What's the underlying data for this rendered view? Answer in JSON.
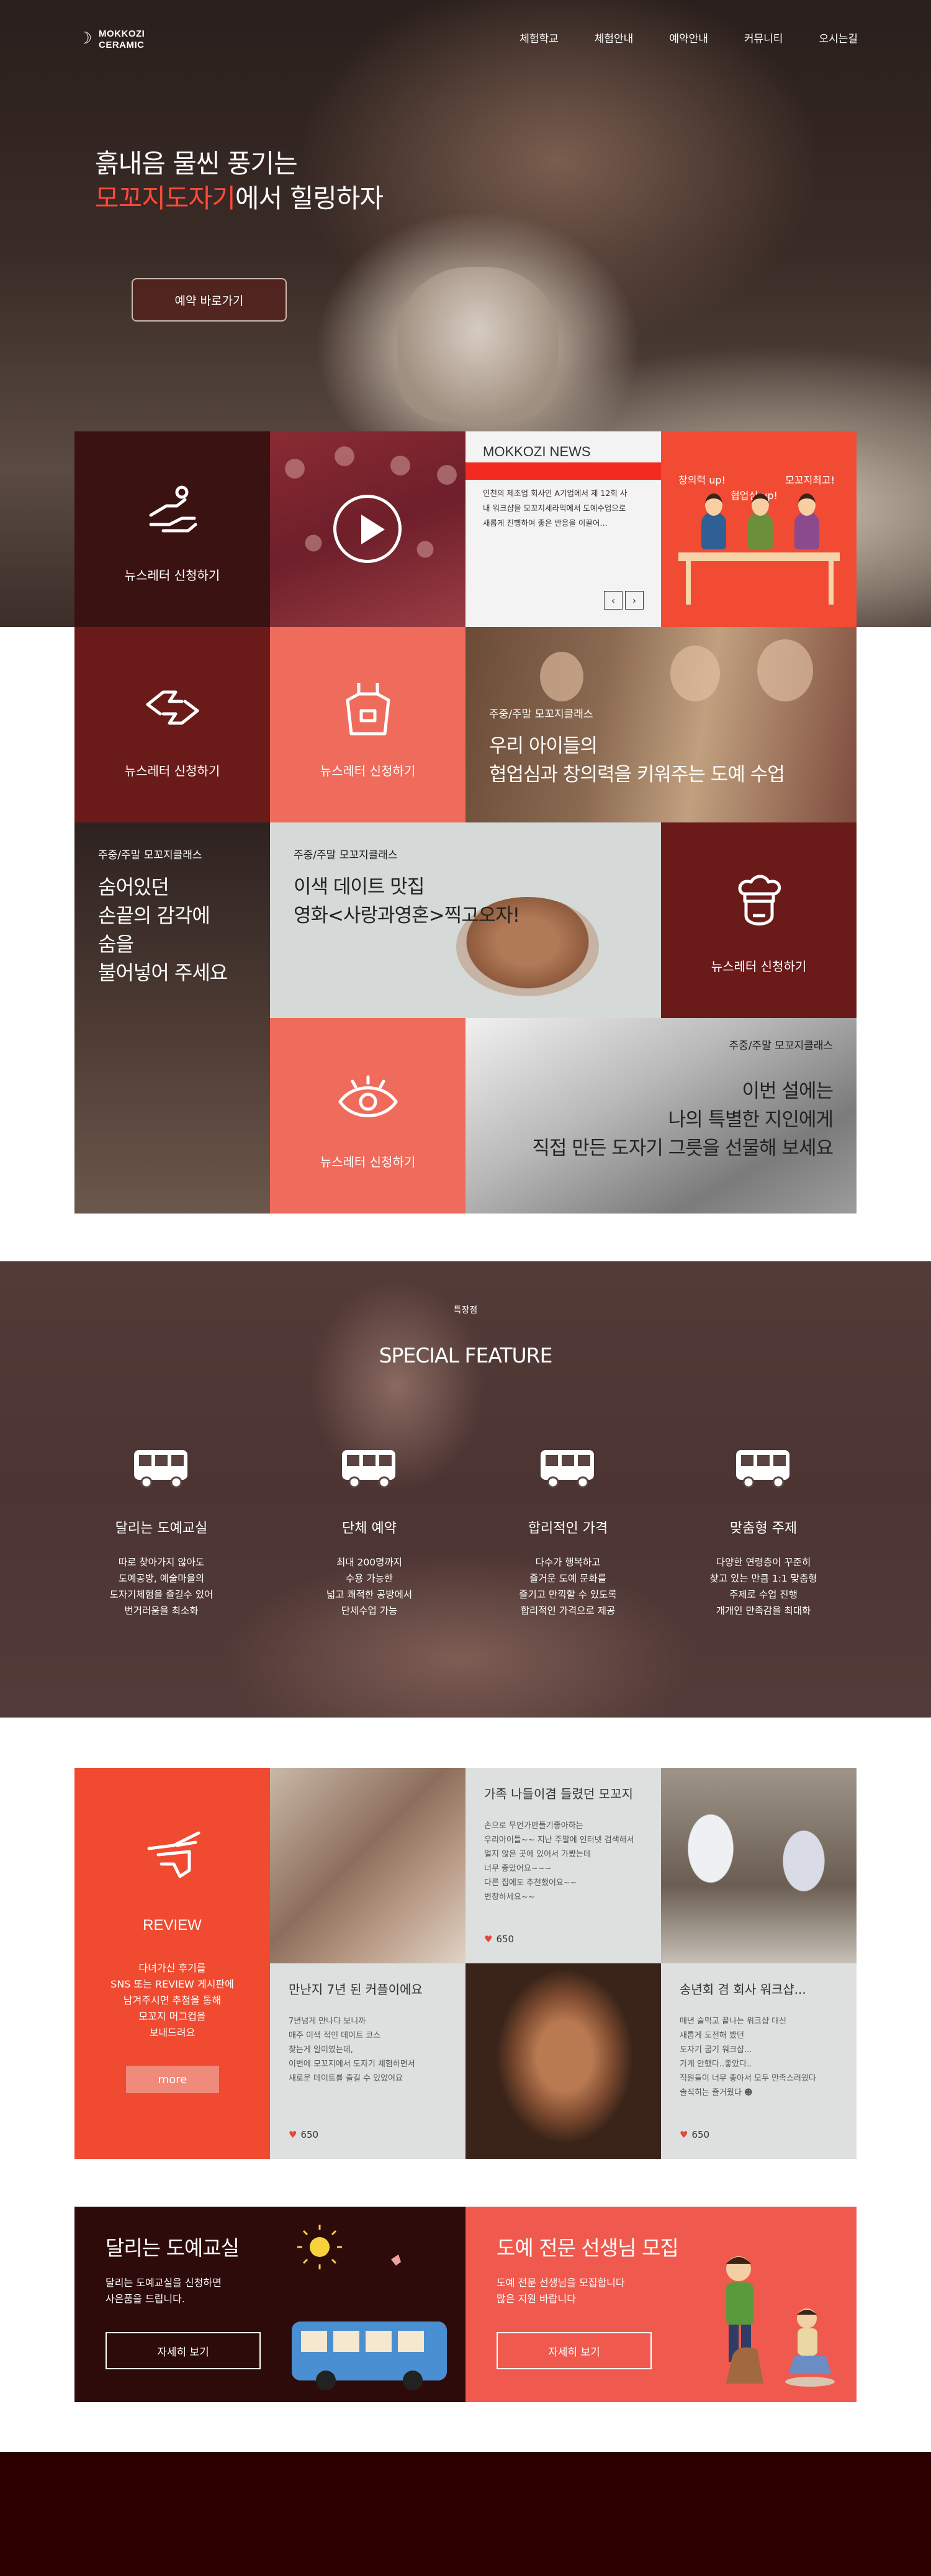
{
  "nav": {
    "logo_line1": "MOKKOZI",
    "logo_line2": "CERAMIC",
    "items": [
      "체험학교",
      "체험안내",
      "예약안내",
      "커뮤니티",
      "오시는길"
    ]
  },
  "hero": {
    "line1": "흙내음 물씬 풍기는",
    "line2_highlight": "모꼬지도자기",
    "line2_rest": "에서 힐링하자",
    "button": "예약 바로가기"
  },
  "grid": {
    "newsletter_label": "뉴스레터 신청하기",
    "news": {
      "title": "MOKKOZI NEWS",
      "body": "인천의 제조업 회사인 A기업에서 제 12회 사내 워크샵을 모꼬지세라믹에서 도예수업으로 새롭게 진행하여 좋은 반응을 이끌어…"
    },
    "cartoon": {
      "bubble1": "창의력 up!",
      "bubble2": "모꼬지최고!",
      "bubble3": "협업심 up!"
    },
    "category": "주중/주말 모꼬지클래스",
    "kids_title": "우리 아이들의\n협업심과 창의력을 키워주는 도예 수업",
    "hands_title": "숨어있던\n손끝의 감각에\n숨을\n불어넣어 주세요",
    "date_title": "이색 데이트 맛집\n영화<사랑과영혼>찍고오자!",
    "gift_title": "이번 설에는\n나의 특별한 지인에게\n직접 만든 도자기 그릇을 선물해 보세요"
  },
  "feature": {
    "sub": "특장점",
    "title": "SPECIAL FEATURE",
    "items": [
      {
        "title": "달리는 도예교실",
        "desc": "따로 찾아가지 않아도\n도예공방, 예술마을의\n도자기체험을 즐길수 있어\n번거러움을 최소화"
      },
      {
        "title": "단체 예약",
        "desc": "최대 200명까지\n수용 가능한\n넓고 쾌적한 공방에서\n단체수업 가능"
      },
      {
        "title": "합리적인 가격",
        "desc": "다수가 행복하고\n즐거운 도예 문화를\n즐기고 만끽할 수 있도록\n합리적인 가격으로 제공"
      },
      {
        "title": "맞춤형 주제",
        "desc": "다양한 연령층이 꾸준히\n찾고 있는 만큼 1:1 맞춤형\n주제로 수업 진행\n개개인 만족감을 최대화"
      }
    ]
  },
  "review": {
    "heading": "REVIEW",
    "desc": "다녀가신 후기를\nSNS 또는 REVIEW 게시판에\n남겨주시면 추첨을 통해\n모꼬지 머그컵을\n보내드려요",
    "more": "more",
    "cards": [
      {
        "title": "가족 나들이겸 들렸던 모꼬지",
        "body": "손으로 무언가만들기좋아하는\n우리아이들~~ 지난 주말에 인터넷 검색해서\n멀지 않은 곳에 있어서 가봤는데\n너무 좋았어요~~~\n다른 집에도 추천했어요~~\n번창하세요~~",
        "likes": "650"
      },
      {
        "title": "만난지 7년 된 커플이에요",
        "body": "7년넘게 만나다 보니까\n매주 이색 적인 데이트 코스\n찾는게 일이였는데,\n이번에 모꼬지에서 도자기 체험하면서\n새로운 데이트를 즐길 수 있었어요",
        "likes": "650"
      },
      {
        "title": "송년회 겸 회사 워크샵...",
        "body": "매년 술먹고 끝나는 워크샵 대신\n새롭게 도전해 봤던\n도자기 굽기 워크샵...\n가게 안했다..좋았다..\n직원들이 너무 좋아서 모두 만족스러웠다\n솔직히는 즐거웠다 ☻",
        "likes": "650"
      }
    ]
  },
  "banners": {
    "left": {
      "title": "달리는 도예교실",
      "desc": "달리는 도예교실을 신청하면\n사은품을 드립니다.",
      "button": "자세히 보기"
    },
    "right": {
      "title": "도예 전문 선생님 모집",
      "desc": "도예 전문 선생님을 모집합니다\n많은 지원 바랍니다",
      "button": "자세히 보기"
    }
  },
  "colors": {
    "accent": "#f05a44",
    "maroon": "#6b1a1a",
    "dark": "#3b1212",
    "coral": "#ef6b5b"
  }
}
